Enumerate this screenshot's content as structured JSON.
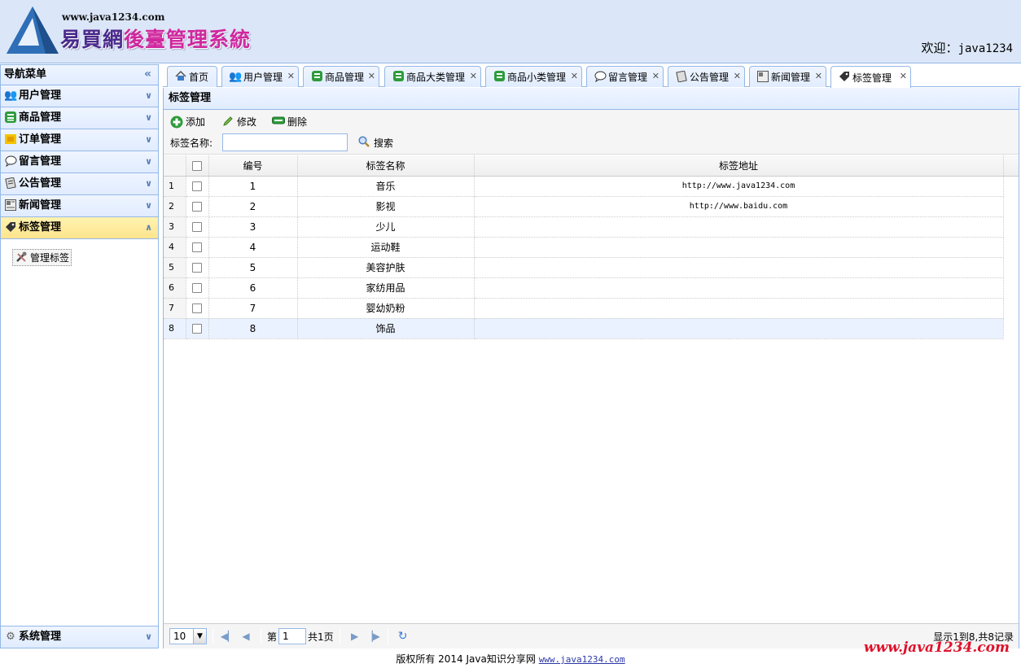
{
  "header": {
    "site_url": "www.java1234.com",
    "title_part1": "易買網",
    "title_part2": "後臺管理系統",
    "welcome_label": "欢迎：",
    "username": "java1234"
  },
  "sidebar": {
    "title": "导航菜单",
    "collapse_glyph": "«",
    "items": [
      {
        "label": "用户管理",
        "icon": "users-icon"
      },
      {
        "label": "商品管理",
        "icon": "list-icon"
      },
      {
        "label": "订单管理",
        "icon": "order-icon"
      },
      {
        "label": "留言管理",
        "icon": "comment-icon"
      },
      {
        "label": "公告管理",
        "icon": "notice-icon"
      },
      {
        "label": "新闻管理",
        "icon": "news-icon"
      },
      {
        "label": "标签管理",
        "icon": "tag-icon",
        "active": true
      }
    ],
    "sub_item": "管理标签",
    "system": "系统管理"
  },
  "tabs": [
    {
      "label": "首页",
      "closable": false
    },
    {
      "label": "用户管理",
      "closable": true
    },
    {
      "label": "商品管理",
      "closable": true
    },
    {
      "label": "商品大类管理",
      "closable": true
    },
    {
      "label": "商品小类管理",
      "closable": true
    },
    {
      "label": "留言管理",
      "closable": true
    },
    {
      "label": "公告管理",
      "closable": true
    },
    {
      "label": "新闻管理",
      "closable": true
    },
    {
      "label": "标签管理",
      "closable": true,
      "selected": true
    }
  ],
  "panel": {
    "title": "标签管理",
    "toolbar": {
      "add": "添加",
      "edit": "修改",
      "delete": "删除",
      "search_label": "标签名称:",
      "search_value": "",
      "search_button": "搜索"
    },
    "grid": {
      "columns": [
        "编号",
        "标签名称",
        "标签地址"
      ],
      "rows": [
        {
          "rn": "1",
          "id": "1",
          "name": "音乐",
          "url": "http://www.java1234.com"
        },
        {
          "rn": "2",
          "id": "2",
          "name": "影视",
          "url": "http://www.baidu.com"
        },
        {
          "rn": "3",
          "id": "3",
          "name": "少儿",
          "url": ""
        },
        {
          "rn": "4",
          "id": "4",
          "name": "运动鞋",
          "url": ""
        },
        {
          "rn": "5",
          "id": "5",
          "name": "美容护肤",
          "url": ""
        },
        {
          "rn": "6",
          "id": "6",
          "name": "家纺用品",
          "url": ""
        },
        {
          "rn": "7",
          "id": "7",
          "name": "婴幼奶粉",
          "url": ""
        },
        {
          "rn": "8",
          "id": "8",
          "name": "饰品",
          "url": "",
          "highlighted": true
        }
      ]
    },
    "pager": {
      "page_size": "10",
      "page_prefix": "第",
      "page_value": "1",
      "page_total": "共1页",
      "info": "显示1到8,共8记录"
    }
  },
  "footer": {
    "text": "版权所有 2014 Java知识分享网",
    "link": "www.java1234.com",
    "watermark": "www.java1234.com"
  }
}
